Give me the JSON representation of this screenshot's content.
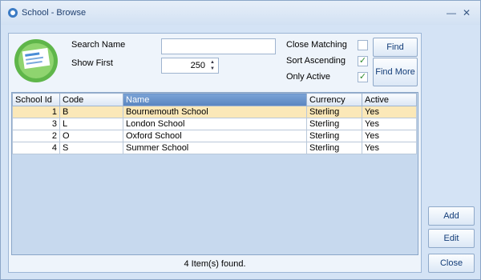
{
  "window": {
    "title": "School - Browse",
    "minimize_glyph": "—",
    "close_glyph": "✕"
  },
  "search": {
    "search_name_label": "Search Name",
    "search_name_value": "",
    "show_first_label": "Show First",
    "show_first_value": "250",
    "close_matching_label": "Close Matching",
    "close_matching_checked": false,
    "sort_ascending_label": "Sort Ascending",
    "sort_ascending_checked": true,
    "only_active_label": "Only Active",
    "only_active_checked": true,
    "find_label": "Find",
    "find_more_label": "Find More"
  },
  "grid": {
    "columns": [
      "School Id",
      "Code",
      "Name",
      "Currency",
      "Active"
    ],
    "rows": [
      [
        "1",
        "B",
        "Bournemouth School",
        "Sterling",
        "Yes"
      ],
      [
        "3",
        "L",
        "London School",
        "Sterling",
        "Yes"
      ],
      [
        "2",
        "O",
        "Oxford School",
        "Sterling",
        "Yes"
      ],
      [
        "4",
        "S",
        "Summer School",
        "Sterling",
        "Yes"
      ]
    ],
    "status": "4 Item(s) found."
  },
  "actions": {
    "add_label": "Add",
    "edit_label": "Edit",
    "close_label": "Close"
  },
  "icons": {
    "app": "app-icon",
    "logo": "school-logo-icon",
    "check": "✓"
  }
}
